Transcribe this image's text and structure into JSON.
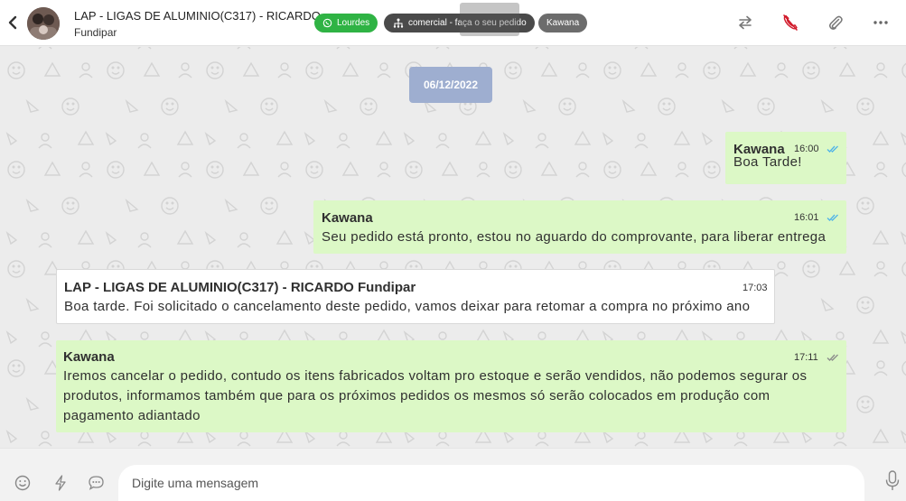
{
  "header": {
    "contact_name": "LAP - LIGAS DE ALUMINIO(C317) - RICARDO",
    "contact_subtitle": "Fundipar",
    "tags": [
      {
        "label": "Lourdes",
        "color": "#2fb344",
        "icon": "whatsapp-icon"
      },
      {
        "label": "comercial - faça o seu pedido",
        "color": "#4a4a4a",
        "icon": "sitemap-icon"
      },
      {
        "label": "Kawana",
        "color": "#6c6c6c"
      }
    ],
    "actions": [
      "transfer-icon",
      "end-call-icon",
      "paperclip-icon",
      "more-options-icon"
    ]
  },
  "chat": {
    "date_divider": "06/12/2022",
    "messages": [
      {
        "direction": "out",
        "sender": "Kawana",
        "time": "16:00",
        "text": "Boa Tarde!",
        "status": "read"
      },
      {
        "direction": "out",
        "sender": "Kawana",
        "time": "16:01",
        "text": "Seu pedido está pronto, estou no aguardo do comprovante, para liberar entrega",
        "status": "read"
      },
      {
        "direction": "in",
        "sender": "LAP - LIGAS DE ALUMINIO(C317) - RICARDO Fundipar",
        "time": "17:03",
        "text": "Boa tarde. Foi solicitado o cancelamento deste pedido, vamos deixar para retomar a compra no próximo ano"
      },
      {
        "direction": "out",
        "sender": "Kawana",
        "time": "17:11",
        "text_lines": [
          "Iremos cancelar o pedido, contudo os itens fabricados voltam pro estoque e serão vendidos, não podemos segurar os",
          "produtos, informamos também que para os próximos pedidos os mesmos só serão colocados em produção com",
          "pagamento adiantado"
        ],
        "status": "delivered"
      }
    ]
  },
  "composer": {
    "placeholder": "Digite uma mensagem",
    "buttons": [
      "emoji-icon",
      "lightning-icon",
      "chat-bubble-icon",
      "microphone-icon"
    ]
  },
  "colors": {
    "outgoing_bubble": "#dcf8c6",
    "incoming_bubble": "#ffffff",
    "date_chip": "#9eaed0",
    "read_tick": "#4fb3e8",
    "delivered_tick": "#8a8a8a",
    "end_call": "#d11a2a",
    "tag_green": "#2fb344"
  }
}
